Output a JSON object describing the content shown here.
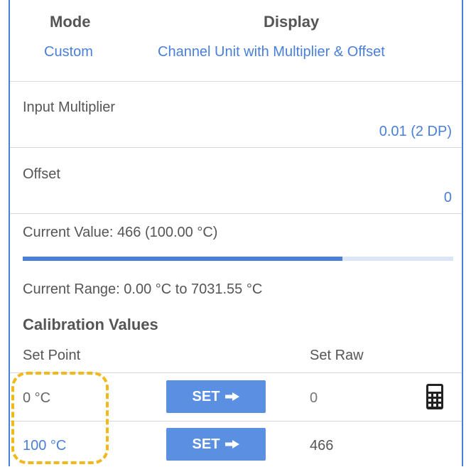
{
  "header": {
    "mode_label": "Mode",
    "mode_value": "Custom",
    "display_label": "Display",
    "display_value": "Channel Unit with Multiplier & Offset"
  },
  "input_multiplier": {
    "label": "Input Multiplier",
    "value": "0.01 (2 DP)"
  },
  "offset": {
    "label": "Offset",
    "value": "0"
  },
  "current_value": {
    "text": "Current Value: 466 (100.00 °C)",
    "progress_fraction": 0.743
  },
  "current_range": "Current Range: 0.00 °C to 7031.55 °C",
  "calibration": {
    "title": "Calibration Values",
    "col_set_point": "Set Point",
    "col_set_raw": "Set Raw",
    "rows": [
      {
        "set_point": "0 °C",
        "button_label": "SET",
        "raw": "0",
        "set_point_active": false
      },
      {
        "set_point": "100 °C",
        "button_label": "SET",
        "raw": "466",
        "set_point_active": true
      }
    ]
  },
  "colors": {
    "accent": "#4a7fd8",
    "button": "#5b8fe2",
    "highlight": "#f0b81a"
  },
  "icons": [
    "right-arrow-icon",
    "calculator-icon"
  ]
}
